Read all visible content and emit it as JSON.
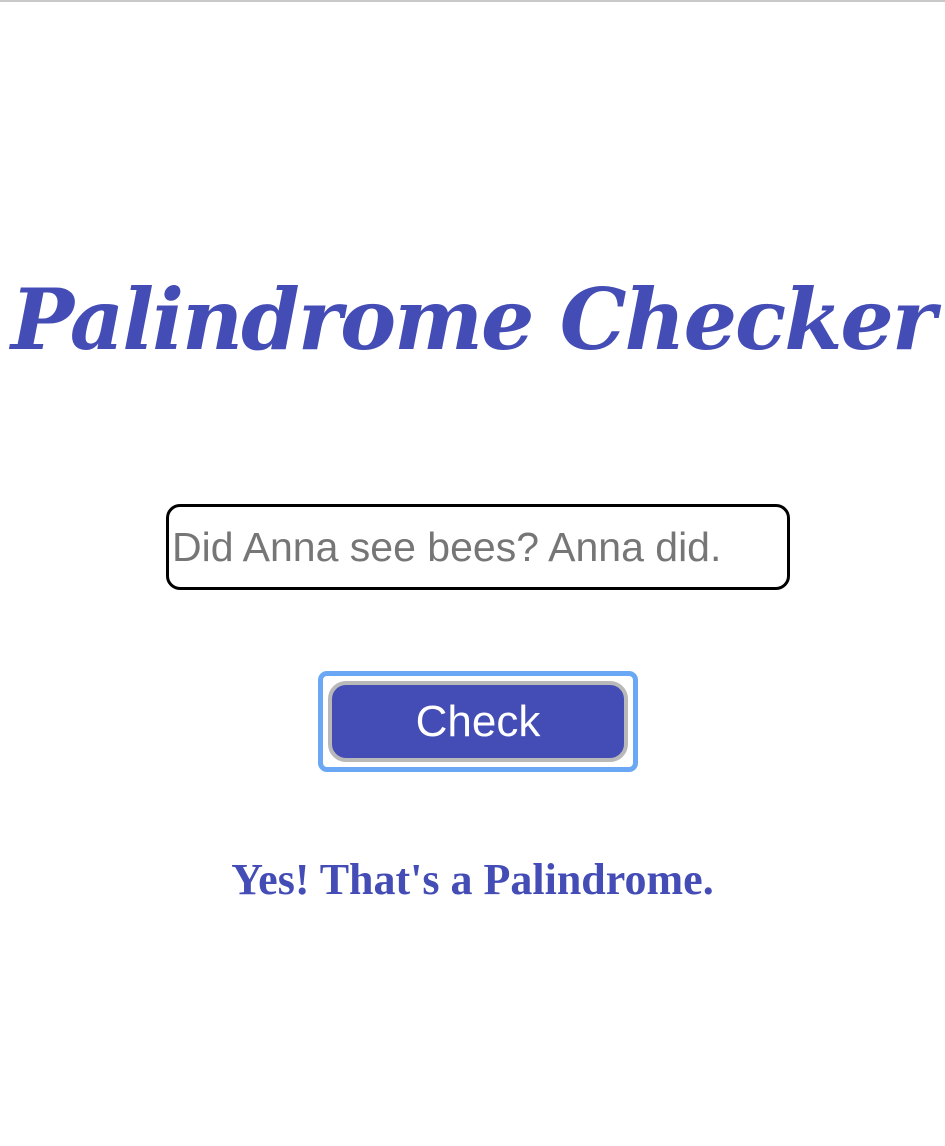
{
  "app": {
    "title": "Palindrome Checker"
  },
  "form": {
    "input_value": "Did Anna see bees? Anna did.",
    "check_label": "Check"
  },
  "result": {
    "message": "Yes! That's a Palindrome."
  },
  "colors": {
    "accent": "#444cb5",
    "focus_ring": "#6aa8f5",
    "input_text": "#767676",
    "button_text": "#ffffff"
  }
}
